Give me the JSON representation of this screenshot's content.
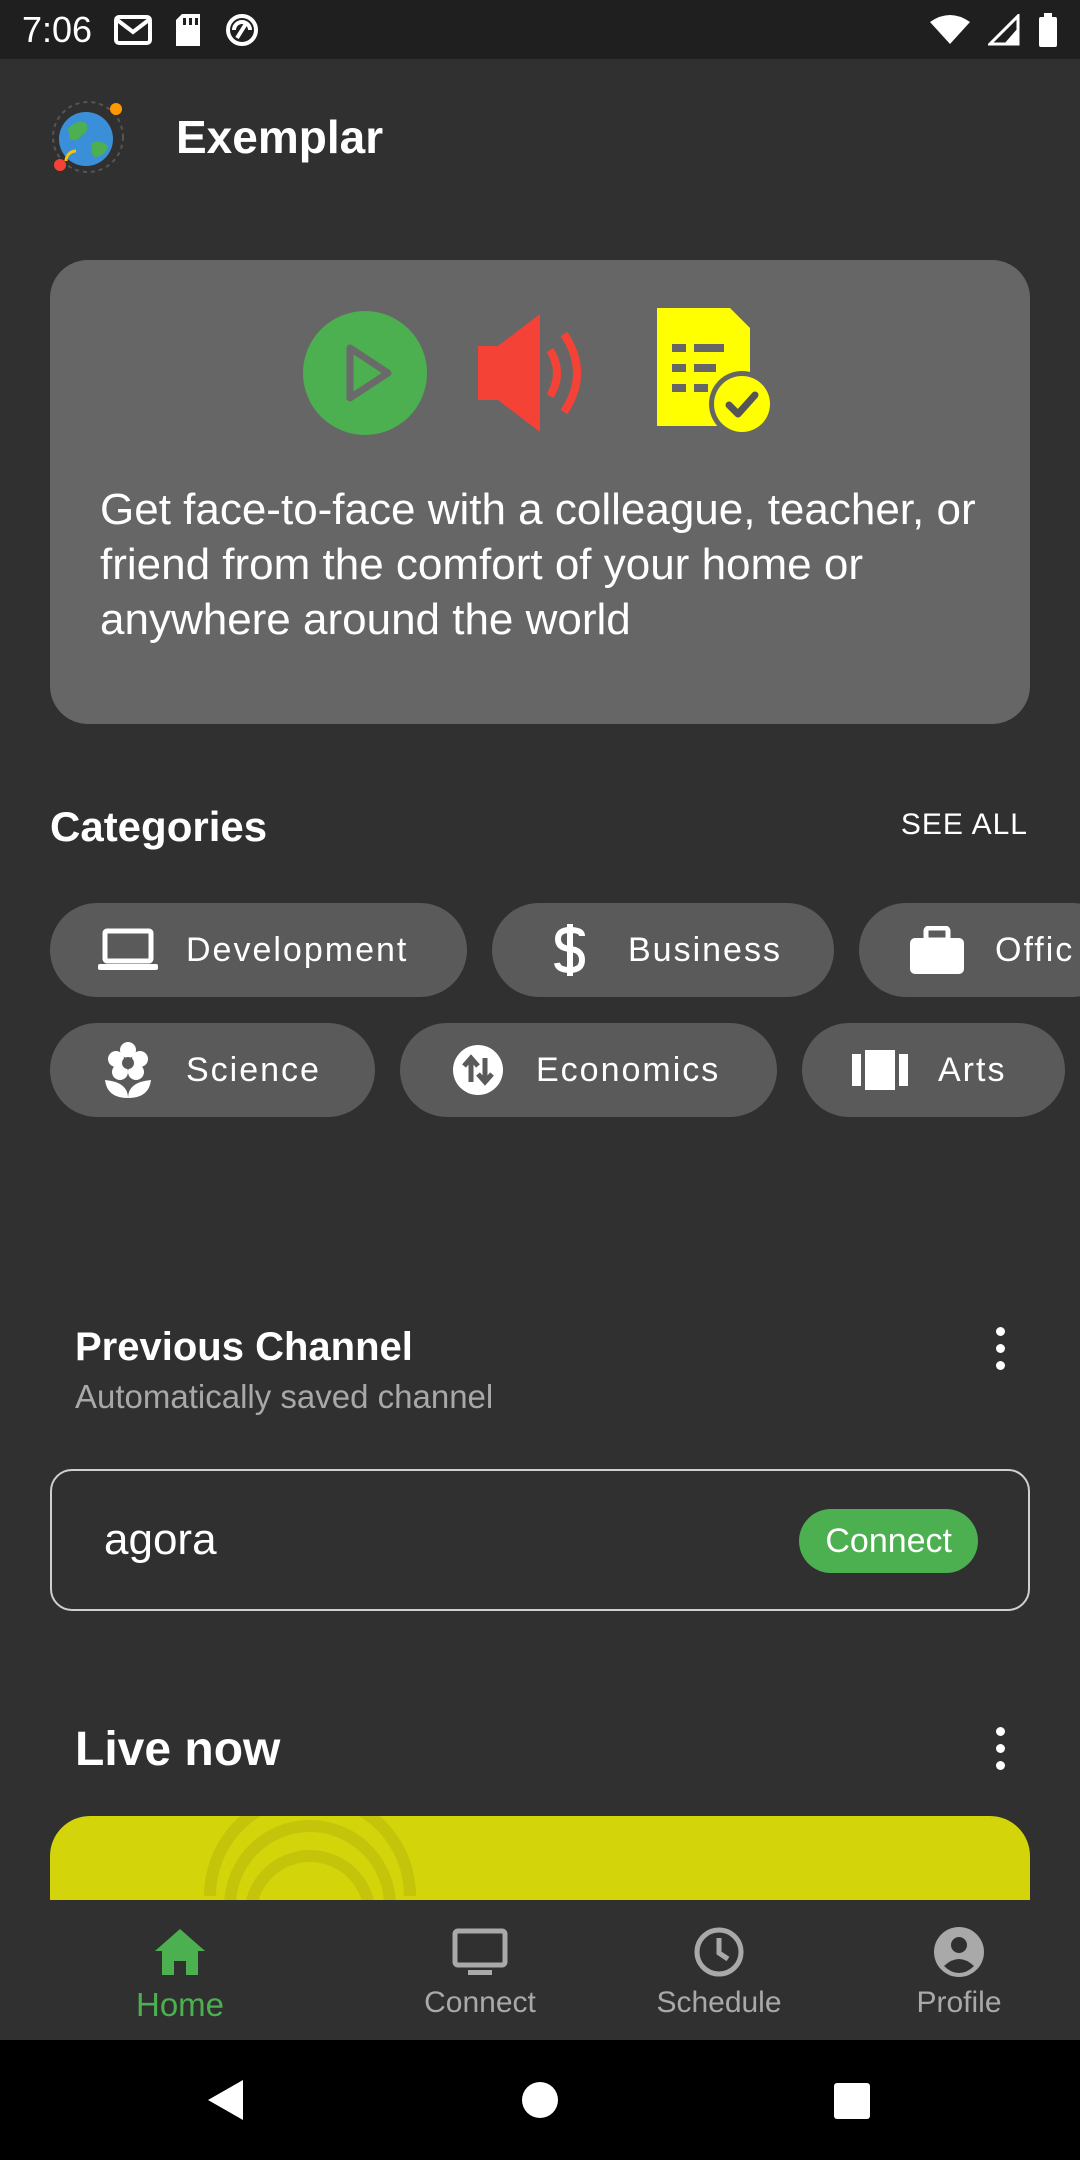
{
  "status_bar": {
    "time": "7:06",
    "left_icons": [
      "gmail-icon",
      "sd-card-icon",
      "vpn-icon"
    ],
    "right_icons": [
      "wifi-icon",
      "signal-icon",
      "battery-icon"
    ]
  },
  "app": {
    "title": "Exemplar",
    "logo_icon": "globe-icon"
  },
  "hero": {
    "icons": [
      "play-circle-icon",
      "speaker-icon",
      "document-check-icon"
    ],
    "text": "Get face-to-face with a colleague, teacher, or friend from the comfort of your home or anywhere around the world",
    "colors": {
      "play": "#4caf50",
      "speaker": "#f44336",
      "document": "#ffff00",
      "card": "#666666"
    }
  },
  "categories": {
    "title": "Categories",
    "see_all": "SEE ALL",
    "row1": [
      {
        "label": "Development",
        "icon": "laptop-icon"
      },
      {
        "label": "Business",
        "icon": "dollar-icon"
      },
      {
        "label": "Offic",
        "icon": "briefcase-icon"
      }
    ],
    "row2": [
      {
        "label": "Science",
        "icon": "flower-icon"
      },
      {
        "label": "Economics",
        "icon": "swap-vertical-icon"
      },
      {
        "label": "Arts",
        "icon": "carousel-icon"
      }
    ]
  },
  "previous_channel": {
    "title": "Previous Channel",
    "subtitle": "Automatically saved channel",
    "channel_name": "agora",
    "connect_label": "Connect"
  },
  "live_now": {
    "title": "Live now",
    "card_color": "#d4d40b"
  },
  "bottom_nav": {
    "items": [
      {
        "label": "Home",
        "icon": "home-icon",
        "active": true
      },
      {
        "label": "Connect",
        "icon": "monitor-icon",
        "active": false
      },
      {
        "label": "Schedule",
        "icon": "clock-icon",
        "active": false
      },
      {
        "label": "Profile",
        "icon": "account-circle-icon",
        "active": false
      }
    ],
    "active_color": "#4caf50"
  },
  "system_nav": [
    "back-icon",
    "home-circle-icon",
    "recents-icon"
  ]
}
